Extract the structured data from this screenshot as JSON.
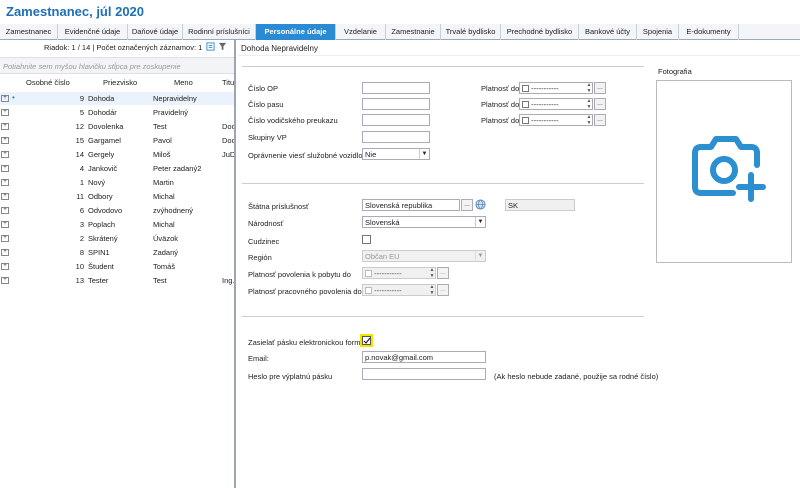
{
  "app": {
    "title": "Zamestnanec, júl 2020"
  },
  "tabs": [
    {
      "label": "Zamestnanec",
      "w": 58
    },
    {
      "label": "Evidenčné údaje",
      "w": 70
    },
    {
      "label": "Daňové údaje",
      "w": 55
    },
    {
      "label": "Rodinní príslušníci",
      "w": 73
    },
    {
      "label": "Personálne údaje",
      "w": 80,
      "active": true
    },
    {
      "label": "Vzdelanie",
      "w": 50
    },
    {
      "label": "Zamestnanie",
      "w": 55
    },
    {
      "label": "Trvalé bydlisko",
      "w": 60
    },
    {
      "label": "Prechodné bydlisko",
      "w": 78
    },
    {
      "label": "Bankové účty",
      "w": 58
    },
    {
      "label": "Spojenia",
      "w": 42
    },
    {
      "label": "E-dokumenty",
      "w": 60
    }
  ],
  "left": {
    "status": "Riadok: 1 / 14 | Počet označených záznamov: 1",
    "group_hint": "Potiahnite sem myšou hlavičku stĺpca pre zoskupenie",
    "columns": [
      "Osobné číslo",
      "Priezvisko",
      "Meno",
      "Titu"
    ],
    "rows": [
      {
        "num": "9",
        "last": "Dohoda",
        "first": "Nepravidelny",
        "title": "",
        "sel": true
      },
      {
        "num": "5",
        "last": "Dohodár",
        "first": "Pravidelný",
        "title": ""
      },
      {
        "num": "12",
        "last": "Dovolenka",
        "first": "Test",
        "title": "Doc."
      },
      {
        "num": "15",
        "last": "Gargamel",
        "first": "Pavol",
        "title": "Doc."
      },
      {
        "num": "14",
        "last": "Gergely",
        "first": "Miloš",
        "title": "JuDr."
      },
      {
        "num": "4",
        "last": "Jankovič",
        "first": "Peter zadaný2",
        "title": ""
      },
      {
        "num": "1",
        "last": "Nový",
        "first": "Martin",
        "title": ""
      },
      {
        "num": "11",
        "last": "Odbory",
        "first": "Michal",
        "title": ""
      },
      {
        "num": "6",
        "last": "Odvodovo",
        "first": "zvýhodnený",
        "title": ""
      },
      {
        "num": "3",
        "last": "Poplach",
        "first": "Michal",
        "title": ""
      },
      {
        "num": "2",
        "last": "Skrátený",
        "first": "Úväzok",
        "title": ""
      },
      {
        "num": "8",
        "last": "SPIN1",
        "first": "Zadaný",
        "title": ""
      },
      {
        "num": "10",
        "last": "Študent",
        "first": "Tomáš",
        "title": ""
      },
      {
        "num": "13",
        "last": "Tester",
        "first": "Test",
        "title": "Ing."
      }
    ]
  },
  "right": {
    "header": "Dohoda Nepravidelny",
    "photo_label": "Fotografia",
    "section1": {
      "cislo_op": "Číslo OP",
      "cislo_pasu": "Číslo pasu",
      "cislo_vodic": "Číslo vodičského preukazu",
      "skupiny_vp": "Skupiny VP",
      "opravnenie": "Oprávnenie viesť služobné vozidlo",
      "opravnenie_value": "Nie",
      "platnost_do": "Platnosť do",
      "date_placeholder": "-----------"
    },
    "section2": {
      "statna_prislusnost": "Štátna príslušnosť",
      "statna_value": "Slovenská republika",
      "statna_code": "SK",
      "narodnost": "Národnosť",
      "narodnost_value": "Slovenská",
      "cudzinec": "Cudzinec",
      "region": "Región",
      "region_value": "Občan EU",
      "platnost_pobyt": "Platnosť povolenia k pobytu do",
      "platnost_prac": "Platnosť pracovného povolenia do",
      "date_placeholder": "-----------"
    },
    "section3": {
      "zasielat": "Zasielať pásku elektronickou formou",
      "email_label": "Email:",
      "email_value": "p.novak@gmail.com",
      "heslo_label": "Heslo pre výplatnú pásku",
      "heslo_note": "(Ak heslo nebude zadané, použije sa rodné číslo)"
    }
  },
  "colors": {
    "accent": "#2a8ad3",
    "camera": "#2b8fd0",
    "highlight": "#f5e400"
  }
}
